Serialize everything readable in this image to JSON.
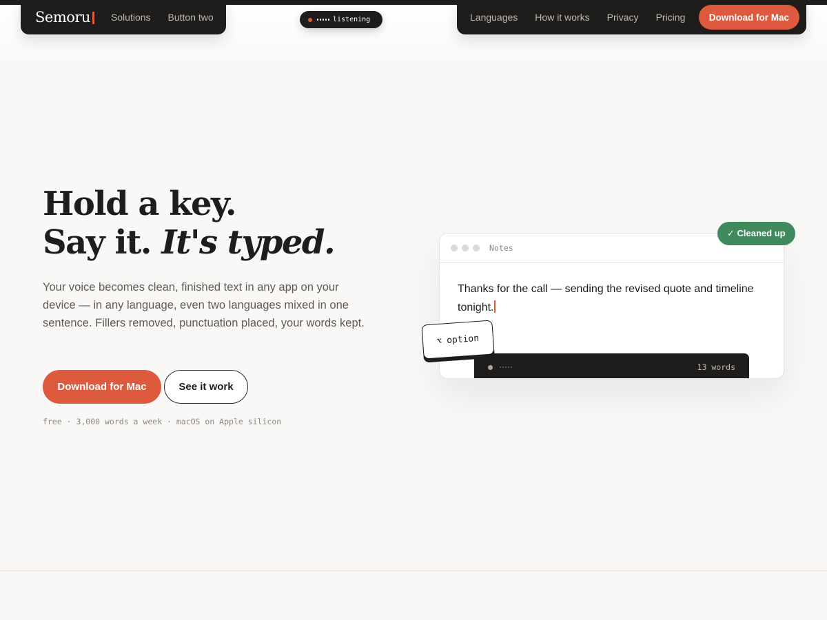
{
  "nav": {
    "logo": "Semoru",
    "left_links": [
      "Solutions",
      "Button two"
    ],
    "right_links": [
      "Languages",
      "How it works",
      "Privacy",
      "Pricing"
    ],
    "cta": "Download for Mac"
  },
  "listening_pill": {
    "text": "listening"
  },
  "hero": {
    "headline_line1": "Hold a key.",
    "headline_line2_plain": "Say it.",
    "headline_line2_italic": "It's typed.",
    "subtext": "Your voice becomes clean, finished text in any app on your device — in any language, even two languages mixed in one sentence. Fillers removed, punctuation placed, your words kept.",
    "primary_cta": "Download for Mac",
    "secondary_cta": "See it work",
    "fineprint": "free · 3,000 words a week · macOS on Apple silicon"
  },
  "demo_card": {
    "title": "Notes",
    "body_text": "Thanks for the call — sending the revised quote and timeline tonight.",
    "badge": "✓ Cleaned up",
    "key_label": "option",
    "key_glyph": "⌥",
    "word_count": "13 words"
  },
  "colors": {
    "accent": "#de5a3f",
    "success": "#3f8a5c",
    "dark": "#1f1d1b",
    "background": "#faf8f6"
  }
}
